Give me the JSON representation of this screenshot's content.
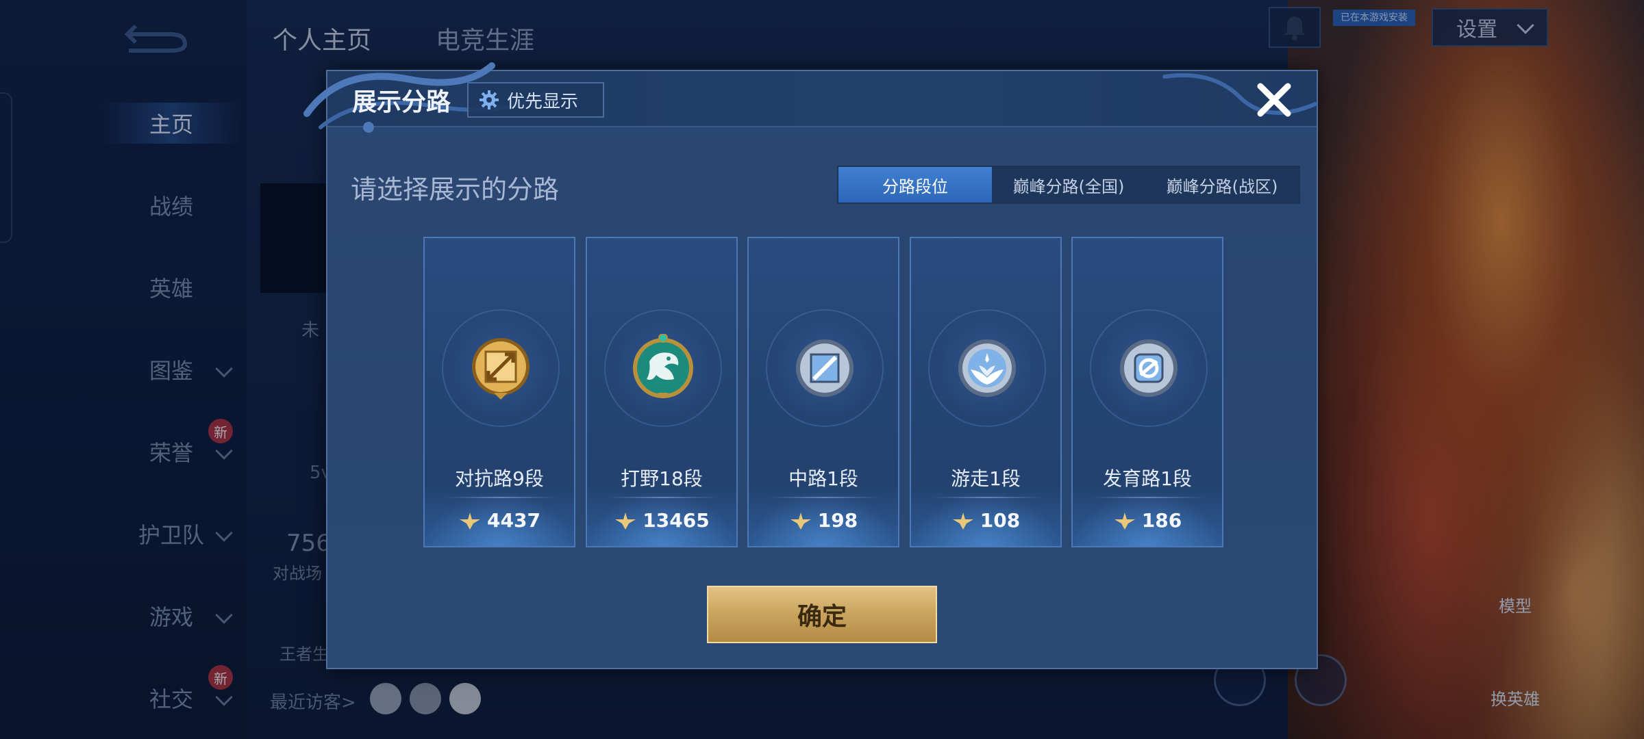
{
  "background": {
    "top_tabs": [
      "个人主页",
      "电竞生涯"
    ],
    "side_nav": [
      {
        "label": "主页",
        "active": true,
        "has_chevron": false,
        "badge": ""
      },
      {
        "label": "战绩",
        "active": false,
        "has_chevron": false,
        "badge": ""
      },
      {
        "label": "英雄",
        "active": false,
        "has_chevron": false,
        "badge": ""
      },
      {
        "label": "图鉴",
        "active": false,
        "has_chevron": true,
        "badge": ""
      },
      {
        "label": "荣誉",
        "active": false,
        "has_chevron": true,
        "badge": "新"
      },
      {
        "label": "护卫队",
        "active": false,
        "has_chevron": true,
        "badge": ""
      },
      {
        "label": "游戏",
        "active": false,
        "has_chevron": true,
        "badge": ""
      },
      {
        "label": "社交",
        "active": false,
        "has_chevron": true,
        "badge": "新"
      }
    ],
    "settings_label": "设置",
    "tag_text": "已在本游戏安装",
    "partial_texts": {
      "not_label": "未",
      "five": "5v",
      "num": "756",
      "battle": "对战场",
      "king": "王者生"
    },
    "recent_visitors_label": "最近访客>",
    "hero_buttons": {
      "model": "模型",
      "switch_hero": "换英雄"
    }
  },
  "modal": {
    "title": "展示分路",
    "priority_button": "优先显示",
    "section_label": "请选择展示的分路",
    "tabs": [
      {
        "label": "分路段位",
        "active": true
      },
      {
        "label": "巅峰分路(全国)",
        "active": false
      },
      {
        "label": "巅峰分路(战区)",
        "active": false
      }
    ],
    "cards": [
      {
        "label": "对抗路9段",
        "score": "4437",
        "emblem": "clash-lane-emblem-icon",
        "color": "#d9a845"
      },
      {
        "label": "打野18段",
        "score": "13465",
        "emblem": "jungle-dragon-emblem-icon",
        "color": "#1f9a8a"
      },
      {
        "label": "中路1段",
        "score": "198",
        "emblem": "mid-lane-emblem-icon",
        "color": "#8fb8e0"
      },
      {
        "label": "游走1段",
        "score": "108",
        "emblem": "roam-emblem-icon",
        "color": "#8fb8e0"
      },
      {
        "label": "发育路1段",
        "score": "186",
        "emblem": "farm-lane-emblem-icon",
        "color": "#8fb8e0"
      }
    ],
    "confirm_label": "确定"
  }
}
